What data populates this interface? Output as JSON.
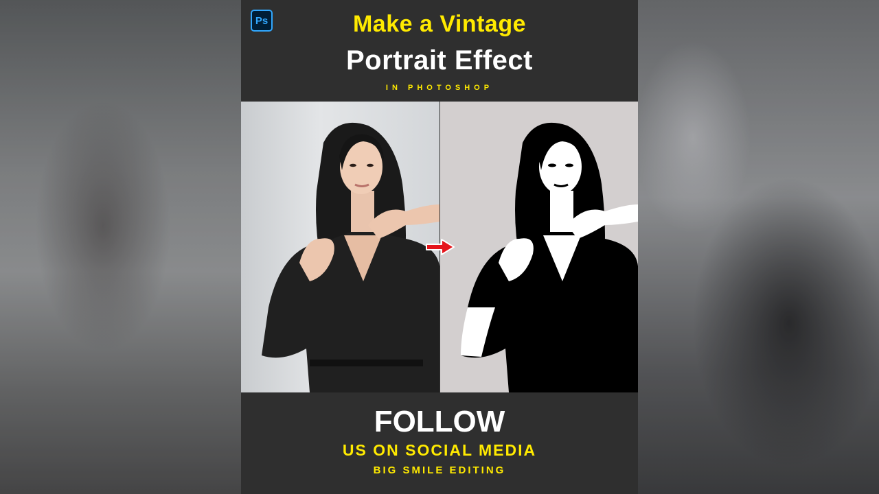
{
  "header": {
    "app_badge": "Ps",
    "title_line1": "Make a Vintage",
    "title_line2": "Portrait Effect",
    "subtitle": "IN PHOTOSHOP"
  },
  "footer": {
    "line1": "FOLLOW",
    "line2": "US ON SOCIAL MEDIA",
    "line3": "BIG SMILE EDITING"
  },
  "colors": {
    "accent_yellow": "#ffea00",
    "panel_dark": "#2f2f2f",
    "arrow_red": "#e5141b",
    "ps_blue": "#31a8ff"
  },
  "icons": {
    "app": "photoshop-logo-icon",
    "transition": "right-arrow-icon"
  }
}
